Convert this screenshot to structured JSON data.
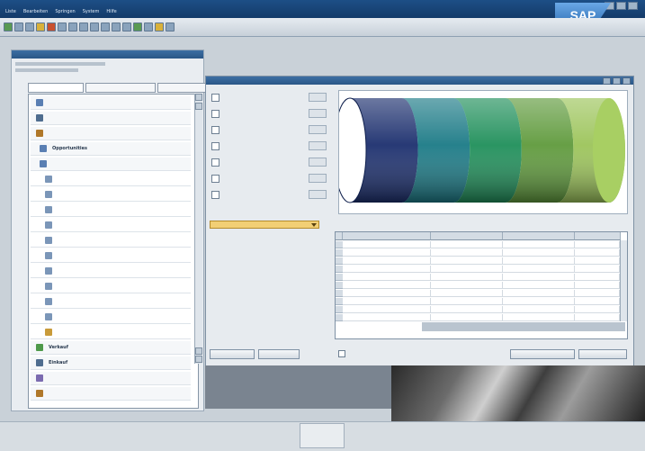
{
  "window": {
    "menu": [
      "Liste",
      "Bearbeiten",
      "Springen",
      "System",
      "Hilfe"
    ],
    "logo_text": "SAP",
    "controls": [
      "minimize",
      "maximize",
      "close"
    ]
  },
  "toolbar": {
    "icons": [
      "enter-icon",
      "save-icon",
      "back-icon",
      "exit-icon",
      "cancel-icon",
      "print-icon",
      "find-icon",
      "find-next-icon",
      "first-page-icon",
      "prev-page-icon",
      "next-page-icon",
      "last-page-icon",
      "create-session-icon",
      "shortcut-icon",
      "help-icon",
      "layout-icon"
    ]
  },
  "left_pane": {
    "title": "",
    "tabs": [],
    "tree": [
      {
        "label": "",
        "icon_color": "#5a7fb3",
        "selected": false
      },
      {
        "label": "",
        "icon_color": "#4f6d8f",
        "selected": false
      },
      {
        "label": "",
        "icon_color": "#b0782a",
        "selected": false
      },
      {
        "label": "Opportunities",
        "icon_color": "#5a7fb3",
        "selected": false
      },
      {
        "label": "",
        "icon_color": "#5a7fb3",
        "selected": false
      },
      {
        "label": "",
        "icon_color": "#7b96b8",
        "selected": false
      },
      {
        "label": "",
        "icon_color": "#7b96b8",
        "selected": false
      },
      {
        "label": "",
        "icon_color": "#7b96b8",
        "selected": false
      },
      {
        "label": "",
        "icon_color": "#7b96b8",
        "selected": false
      },
      {
        "label": "",
        "icon_color": "#7b96b8",
        "selected": false
      },
      {
        "label": "",
        "icon_color": "#7b96b8",
        "selected": false
      },
      {
        "label": "",
        "icon_color": "#7b96b8",
        "selected": false
      },
      {
        "label": "",
        "icon_color": "#7b96b8",
        "selected": false
      },
      {
        "label": "",
        "icon_color": "#7b96b8",
        "selected": false
      },
      {
        "label": "",
        "icon_color": "#7b96b8",
        "selected": false
      },
      {
        "label": "",
        "icon_color": "#c99b3a",
        "selected": true
      },
      {
        "label": "Verkauf",
        "icon_color": "#4e9a4a",
        "selected": false
      },
      {
        "label": "Einkauf",
        "icon_color": "#4f6d8f",
        "selected": false
      },
      {
        "label": "",
        "icon_color": "#7b6bb0",
        "selected": false
      },
      {
        "label": "",
        "icon_color": "#b0782a",
        "selected": false
      }
    ]
  },
  "main_panel": {
    "title": "",
    "checkboxes": [
      "",
      "",
      "",
      "",
      "",
      "",
      ""
    ],
    "select_label": "",
    "select_value": "",
    "grid": {
      "columns": [
        "",
        "",
        ""
      ],
      "rows": [
        {
          "phase": "",
          "amount": "",
          "weighted": "",
          "count": ""
        },
        {
          "phase": "",
          "amount": "",
          "weighted": "",
          "count": ""
        },
        {
          "phase": "",
          "amount": "",
          "weighted": "",
          "count": ""
        },
        {
          "phase": "",
          "amount": "",
          "weighted": "",
          "count": ""
        },
        {
          "phase": "",
          "amount": "",
          "weighted": "",
          "count": ""
        }
      ],
      "total_amount": "",
      "total_weighted": ""
    },
    "buttons": {
      "left1": "",
      "left2": "",
      "right1": "",
      "right2": ""
    },
    "bottom_checkbox": ""
  },
  "funnel_colors": [
    "#1c2f6e",
    "#1b7a86",
    "#1f8f5a",
    "#5f9a3c",
    "#9cc45a"
  ],
  "status": {
    "line1": "",
    "line2": ""
  }
}
